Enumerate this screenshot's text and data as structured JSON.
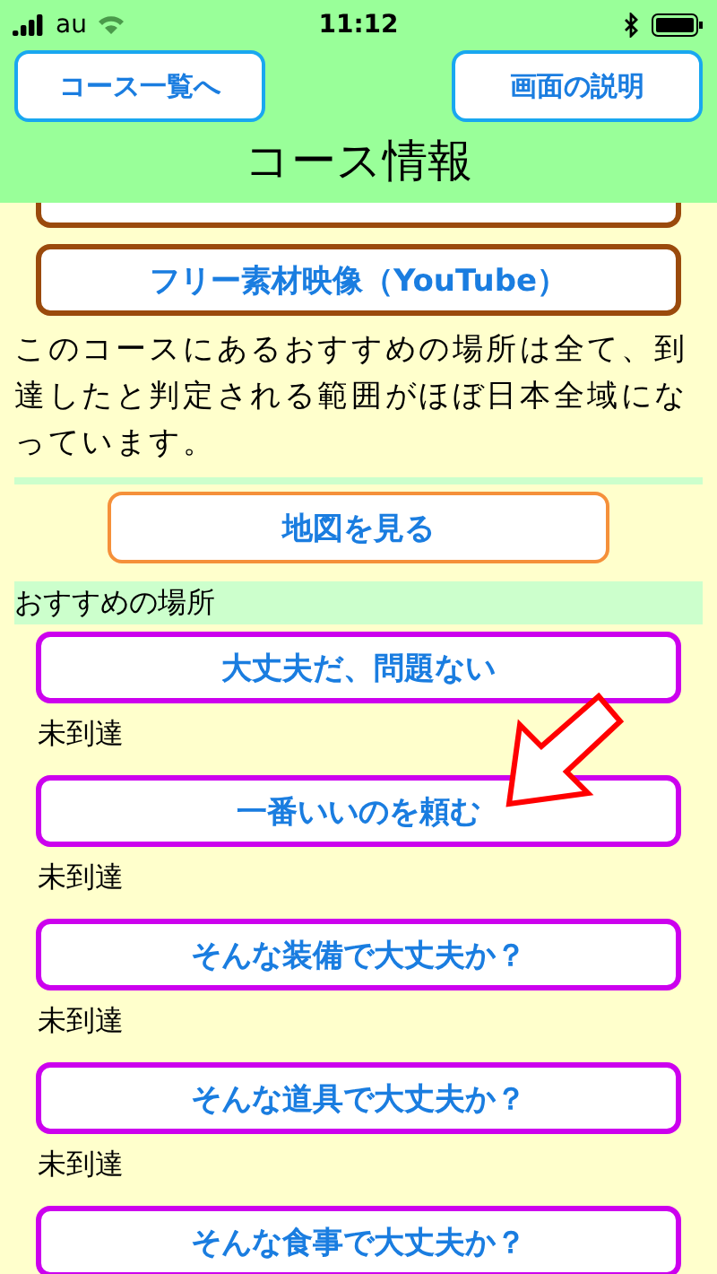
{
  "status_bar": {
    "carrier": "au",
    "time": "11:12"
  },
  "header": {
    "back_button": "コース一覧へ",
    "help_button": "画面の説明",
    "title": "コース情報"
  },
  "links": [
    {
      "kind": "cutoff"
    },
    {
      "label": "フリー素材映像（YouTube）",
      "kind": "link"
    }
  ],
  "description": "このコースにあるおすすめの場所は全て、到達したと判定される範囲がほぼ日本全域になっています。",
  "map_button": "地図を見る",
  "places_heading": "おすすめの場所",
  "places": [
    {
      "name": "大丈夫だ、問題ない",
      "status": "未到達"
    },
    {
      "name": "一番いいのを頼む",
      "status": "未到達"
    },
    {
      "name": "そんな装備で大丈夫か？",
      "status": "未到達"
    },
    {
      "name": "そんな道具で大丈夫か？",
      "status": "未到達"
    },
    {
      "name": "そんな食事で大丈夫か？"
    }
  ]
}
